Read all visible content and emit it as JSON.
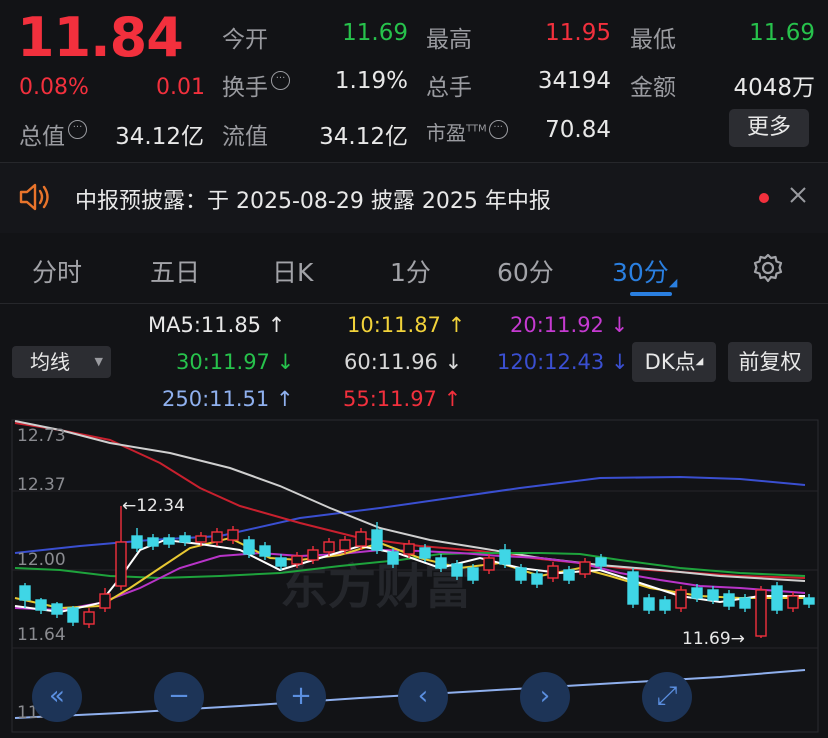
{
  "quote": {
    "price": "11.84",
    "change_pct": "0.08%",
    "change": "0.01",
    "open_label": "今开",
    "open": "11.69",
    "high_label": "最高",
    "high": "11.95",
    "low_label": "最低",
    "low": "11.69",
    "turnover_label": "换手",
    "turnover": "1.19%",
    "volume_label": "总手",
    "volume": "34194",
    "amount_label": "金额",
    "amount": "4048万",
    "mktcap_label": "总值",
    "mktcap": "34.12亿",
    "float_label": "流值",
    "float": "34.12亿",
    "pe_label": "市盈",
    "pe_sup": "TTM",
    "pe": "70.84",
    "more": "更多"
  },
  "notice": {
    "text": "中报预披露：于 2025-08-29 披露 2025 年中报",
    "icon": "speaker-icon",
    "dot_color": "#f2303d"
  },
  "tabs": [
    {
      "label": "分时"
    },
    {
      "label": "五日"
    },
    {
      "label": "日K"
    },
    {
      "label": "1分"
    },
    {
      "label": "60分"
    },
    {
      "label": "30分"
    }
  ],
  "active_tab": "30分",
  "indicator": {
    "select_label": "均线",
    "ma": [
      {
        "text": "MA5:11.85 ↑",
        "color": "#e8e8e8"
      },
      {
        "text": "10:11.87 ↑",
        "color": "#f1d23a"
      },
      {
        "text": "20:11.92 ↓",
        "color": "#c53ad1"
      },
      {
        "text": "30:11.97 ↓",
        "color": "#27c24c"
      },
      {
        "text": "60:11.96 ↓",
        "color": "#d8d8d8"
      },
      {
        "text": "120:12.43 ↓",
        "color": "#3a4fd1"
      },
      {
        "text": "250:11.51 ↑",
        "color": "#8fb0ee"
      },
      {
        "text": "55:11.97 ↑",
        "color": "#f2303d"
      }
    ],
    "dk_label": "DK点",
    "adjust_label": "前复权"
  },
  "chart": {
    "y_labels": [
      "12.73",
      "12.37",
      "12.00",
      "11.64",
      "11.28"
    ],
    "high_marker": "←12.34",
    "low_marker": "11.69→",
    "watermark": "东方财富"
  },
  "colors": {
    "up": "#f2303d",
    "down": "#27c24c",
    "accent": "#2a7fe0",
    "bear_candle": "#3fd6e6"
  }
}
